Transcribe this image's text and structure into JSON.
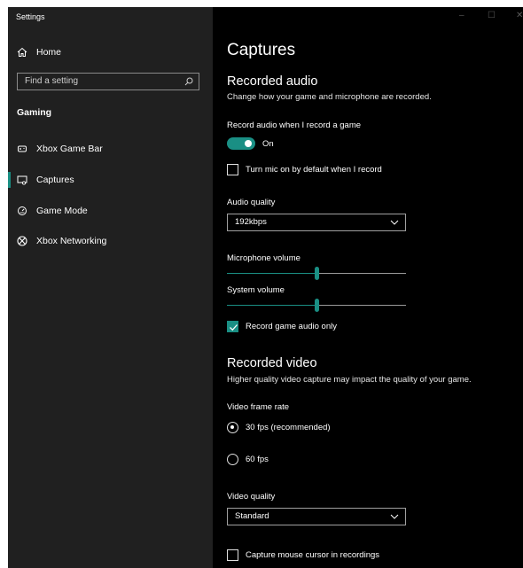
{
  "window": {
    "title": "Settings",
    "controls": [
      "–",
      "☐",
      "✕"
    ]
  },
  "sidebar": {
    "home": "Home",
    "search_placeholder": "Find a setting",
    "section": "Gaming",
    "items": [
      {
        "label": "Xbox Game Bar",
        "icon": "game-bar-icon"
      },
      {
        "label": "Captures",
        "icon": "captures-icon",
        "selected": true
      },
      {
        "label": "Game Mode",
        "icon": "game-mode-icon"
      },
      {
        "label": "Xbox Networking",
        "icon": "xbox-icon"
      }
    ]
  },
  "main": {
    "title": "Captures",
    "audio": {
      "heading": "Recorded audio",
      "desc": "Change how your game and microphone are recorded.",
      "record_label": "Record audio when I record a game",
      "toggle_state": "On",
      "mic_default": {
        "label": "Turn mic on by default when I record",
        "checked": false
      },
      "quality_label": "Audio quality",
      "quality_value": "192kbps",
      "mic_volume": {
        "label": "Microphone volume",
        "value": 0.5
      },
      "system_volume": {
        "label": "System volume",
        "value": 0.5
      },
      "game_only": {
        "label": "Record game audio only",
        "checked": true
      }
    },
    "video": {
      "heading": "Recorded video",
      "desc": "Higher quality video capture may impact the quality of your game.",
      "frame_rate_label": "Video frame rate",
      "fps30": "30 fps (recommended)",
      "fps60": "60 fps",
      "selected_fps": "30",
      "quality_label": "Video quality",
      "quality_value": "Standard",
      "cursor": {
        "label": "Capture mouse cursor in recordings",
        "checked": false
      }
    }
  },
  "colors": {
    "accent": "#1a8f84",
    "sidebar_bg": "#202020",
    "content_bg": "#000000"
  }
}
